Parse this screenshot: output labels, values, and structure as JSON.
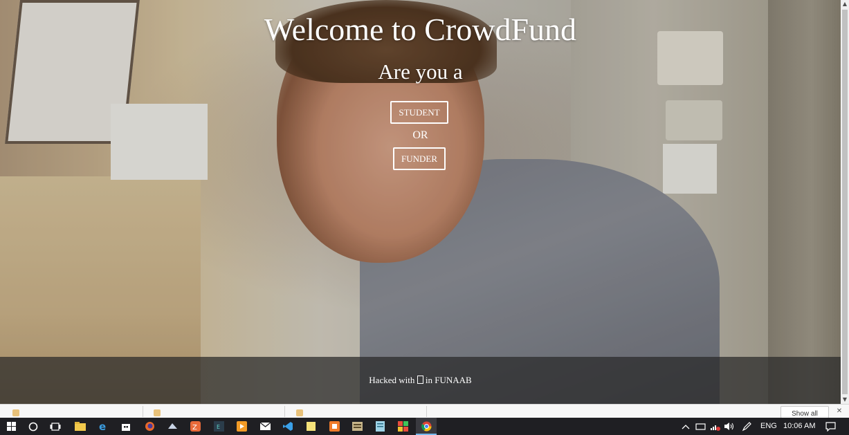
{
  "hero": {
    "title": "Welcome to CrowdFund",
    "subtitle": "Are you a",
    "student_label": "STUDENT",
    "or_label": "OR",
    "funder_label": "FUNDER"
  },
  "footer": {
    "text_before": "Hacked with ",
    "text_after": " in FUNAAB"
  },
  "download_bar": {
    "show_all_label": "Show all"
  },
  "taskbar": {
    "language": "ENG",
    "time": "10:06 AM",
    "pinned_apps": [
      "file-explorer",
      "edge",
      "store",
      "firefox",
      "app",
      "app",
      "app",
      "media-player",
      "mail",
      "vscode",
      "sticky-notes",
      "app",
      "app",
      "app",
      "app",
      "chrome"
    ]
  },
  "colors": {
    "hero_text": "#ffffff",
    "footer_bg": "#282828",
    "taskbar_bg": "#1f1f23",
    "accent_blue": "#76b9ed"
  }
}
